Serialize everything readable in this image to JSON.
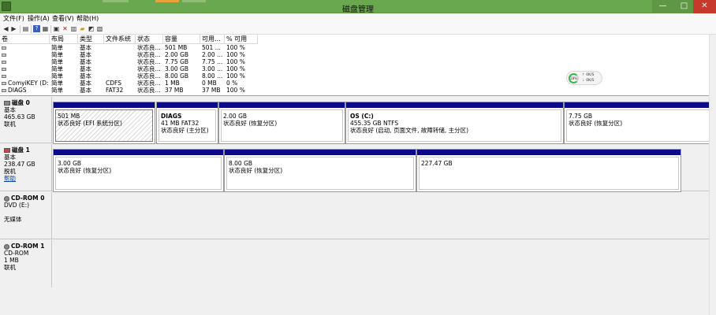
{
  "window": {
    "title": "磁盘管理",
    "minimize_glyph": "—",
    "maximize_glyph": "□",
    "close_glyph": "✕"
  },
  "menu": [
    "文件(F)",
    "操作(A)",
    "查看(V)",
    "帮助(H)"
  ],
  "toolbar_icons": [
    "back-icon",
    "forward-icon",
    "list-view-icon",
    "help-icon",
    "properties-icon",
    "delete-icon",
    "refresh-icon",
    "open-folder-icon",
    "explore-icon",
    "settings-icon"
  ],
  "volume_table": {
    "columns": [
      "卷",
      "布局",
      "类型",
      "文件系统",
      "状态",
      "容量",
      "可用...",
      "% 可用"
    ],
    "rows": [
      {
        "vol": "",
        "layout": "简单",
        "type": "基本",
        "fs": "",
        "status": "状态良...",
        "capacity": "501 MB",
        "free": "501 ...",
        "pct": "100 %"
      },
      {
        "vol": "",
        "layout": "简单",
        "type": "基本",
        "fs": "",
        "status": "状态良...",
        "capacity": "2.00 GB",
        "free": "2.00 ...",
        "pct": "100 %"
      },
      {
        "vol": "",
        "layout": "简单",
        "type": "基本",
        "fs": "",
        "status": "状态良...",
        "capacity": "7.75 GB",
        "free": "7.75 ...",
        "pct": "100 %"
      },
      {
        "vol": "",
        "layout": "简单",
        "type": "基本",
        "fs": "",
        "status": "状态良...",
        "capacity": "3.00 GB",
        "free": "3.00 ...",
        "pct": "100 %"
      },
      {
        "vol": "",
        "layout": "简单",
        "type": "基本",
        "fs": "",
        "status": "状态良...",
        "capacity": "8.00 GB",
        "free": "8.00 ...",
        "pct": "100 %"
      },
      {
        "vol": "ComyiKEY (D:)",
        "layout": "简单",
        "type": "基本",
        "fs": "CDFS",
        "status": "状态良...",
        "capacity": "1 MB",
        "free": "0 MB",
        "pct": "0 %"
      },
      {
        "vol": "DIAGS",
        "layout": "简单",
        "type": "基本",
        "fs": "FAT32",
        "status": "状态良...",
        "capacity": "37 MB",
        "free": "37 MB",
        "pct": "100 %"
      }
    ]
  },
  "status_widget": {
    "gauge_text": "18%",
    "line1": "0K/S",
    "line2": "0K/S",
    "up_color": "#d9342b",
    "down_color": "#3cb54a"
  },
  "disks": [
    {
      "name": "磁盘 0",
      "lines": [
        "基本",
        "465.63 GB",
        "联机"
      ],
      "partitions": [
        {
          "name": "",
          "size": "501 MB",
          "status": "状态良好 (EFI 系统分区)",
          "hatched": true
        },
        {
          "name": "DIAGS",
          "size": "41 MB FAT32",
          "status": "状态良好 (主分区)"
        },
        {
          "name": "",
          "size": "2.00 GB",
          "status": "状态良好 (恢复分区)"
        },
        {
          "name": "OS  (C:)",
          "size": "455.35 GB NTFS",
          "status": "状态良好 (启动, 页面文件, 故障转储, 主分区)"
        },
        {
          "name": "",
          "size": "7.75 GB",
          "status": "状态良好 (恢复分区)"
        }
      ]
    },
    {
      "name": "磁盘 1",
      "lines": [
        "基本",
        "238.47 GB",
        "脱机"
      ],
      "link": "帮助",
      "partitions": [
        {
          "name": "",
          "size": "3.00 GB",
          "status": "状态良好 (恢复分区)"
        },
        {
          "name": "",
          "size": "8.00 GB",
          "status": "状态良好 (恢复分区)"
        },
        {
          "name": "",
          "size": "227.47 GB",
          "status": ""
        }
      ]
    },
    {
      "name": "CD-ROM 0",
      "lines": [
        "DVD (E:)",
        "",
        "无媒体"
      ]
    },
    {
      "name": "CD-ROM 1",
      "lines": [
        "CD-ROM",
        "1 MB",
        "联机"
      ]
    }
  ]
}
